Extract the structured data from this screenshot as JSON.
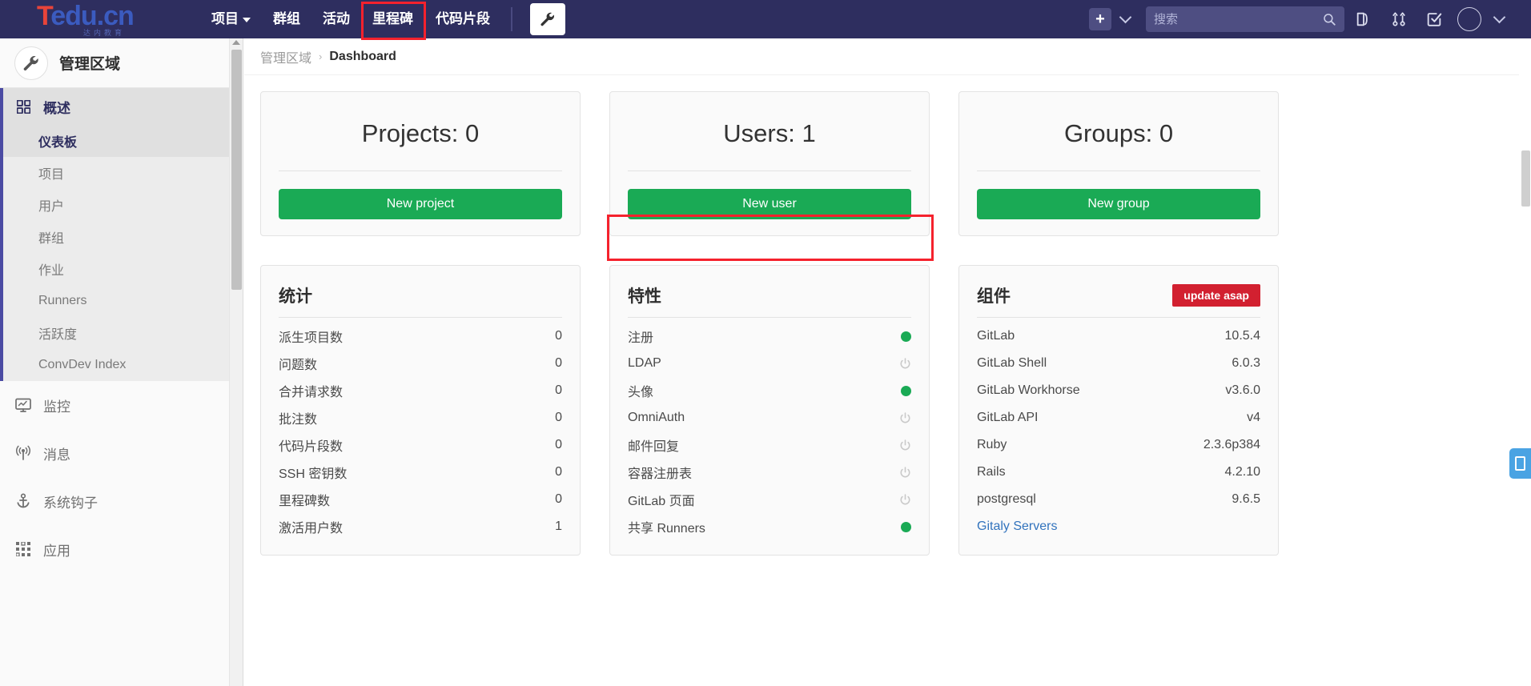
{
  "topnav": {
    "logo": {
      "t": "T",
      "rest": "edu.cn",
      "sub": "达内教育"
    },
    "items": [
      {
        "label": "项目",
        "has_caret": true
      },
      {
        "label": "群组",
        "has_caret": false
      },
      {
        "label": "活动",
        "has_caret": false
      },
      {
        "label": "里程碑",
        "has_caret": false
      },
      {
        "label": "代码片段",
        "has_caret": false
      }
    ],
    "admin_icon": "wrench-icon",
    "plus_label": "+",
    "search": {
      "placeholder": "搜索",
      "value": "",
      "icon": "search-icon"
    },
    "icons": [
      "issues-icon",
      "merge-requests-icon",
      "todos-icon"
    ],
    "avatar": "avatar-icon"
  },
  "sidebar": {
    "header": {
      "title": "管理区域",
      "icon": "wrench-icon"
    },
    "overview": {
      "label": "概述",
      "icon": "overview-grid-icon"
    },
    "sub_items": [
      {
        "label": "仪表板",
        "selected": true
      },
      {
        "label": "项目",
        "selected": false
      },
      {
        "label": "用户",
        "selected": false
      },
      {
        "label": "群组",
        "selected": false
      },
      {
        "label": "作业",
        "selected": false
      },
      {
        "label": "Runners",
        "selected": false
      },
      {
        "label": "活跃度",
        "selected": false
      },
      {
        "label": "ConvDev Index",
        "selected": false
      }
    ],
    "items": [
      {
        "label": "监控",
        "icon": "monitor-icon"
      },
      {
        "label": "消息",
        "icon": "broadcast-icon"
      },
      {
        "label": "系统钩子",
        "icon": "anchor-icon"
      },
      {
        "label": "应用",
        "icon": "apps-grid-icon"
      }
    ]
  },
  "breadcrumb": {
    "root": "管理区域",
    "sep": "›",
    "current": "Dashboard"
  },
  "cards": {
    "projects": {
      "count": "Projects: 0",
      "button": "New project"
    },
    "users": {
      "count": "Users: 1",
      "button": "New user",
      "highlighted": true
    },
    "groups": {
      "count": "Groups: 0",
      "button": "New group"
    }
  },
  "statistics": {
    "title": "统计",
    "rows": [
      {
        "label": "派生项目数",
        "value": "0"
      },
      {
        "label": "问题数",
        "value": "0"
      },
      {
        "label": "合并请求数",
        "value": "0"
      },
      {
        "label": "批注数",
        "value": "0"
      },
      {
        "label": "代码片段数",
        "value": "0"
      },
      {
        "label": "SSH 密钥数",
        "value": "0"
      },
      {
        "label": "里程碑数",
        "value": "0"
      },
      {
        "label": "激活用户数",
        "value": "1"
      }
    ]
  },
  "features": {
    "title": "特性",
    "rows": [
      {
        "label": "注册",
        "enabled": true
      },
      {
        "label": "LDAP",
        "enabled": false
      },
      {
        "label": "头像",
        "enabled": true
      },
      {
        "label": "OmniAuth",
        "enabled": false
      },
      {
        "label": "邮件回复",
        "enabled": false
      },
      {
        "label": "容器注册表",
        "enabled": false
      },
      {
        "label": "GitLab 页面",
        "enabled": false
      },
      {
        "label": "共享 Runners",
        "enabled": true
      }
    ]
  },
  "components": {
    "title": "组件",
    "badge": "update asap",
    "rows": [
      {
        "label": "GitLab",
        "value": "10.5.4",
        "link": false
      },
      {
        "label": "GitLab Shell",
        "value": "6.0.3",
        "link": false
      },
      {
        "label": "GitLab Workhorse",
        "value": "v3.6.0",
        "link": false
      },
      {
        "label": "GitLab API",
        "value": "v4",
        "link": false
      },
      {
        "label": "Ruby",
        "value": "2.3.6p384",
        "link": false
      },
      {
        "label": "Rails",
        "value": "4.2.10",
        "link": false
      },
      {
        "label": "postgresql",
        "value": "9.6.5",
        "link": false
      },
      {
        "label": "Gitaly Servers",
        "value": "",
        "link": true
      }
    ]
  },
  "colors": {
    "nav_bg": "#2e2e5f",
    "green": "#1aaa55",
    "red_badge": "#d22030",
    "highlight": "#f5222d",
    "link": "#3273bd"
  }
}
